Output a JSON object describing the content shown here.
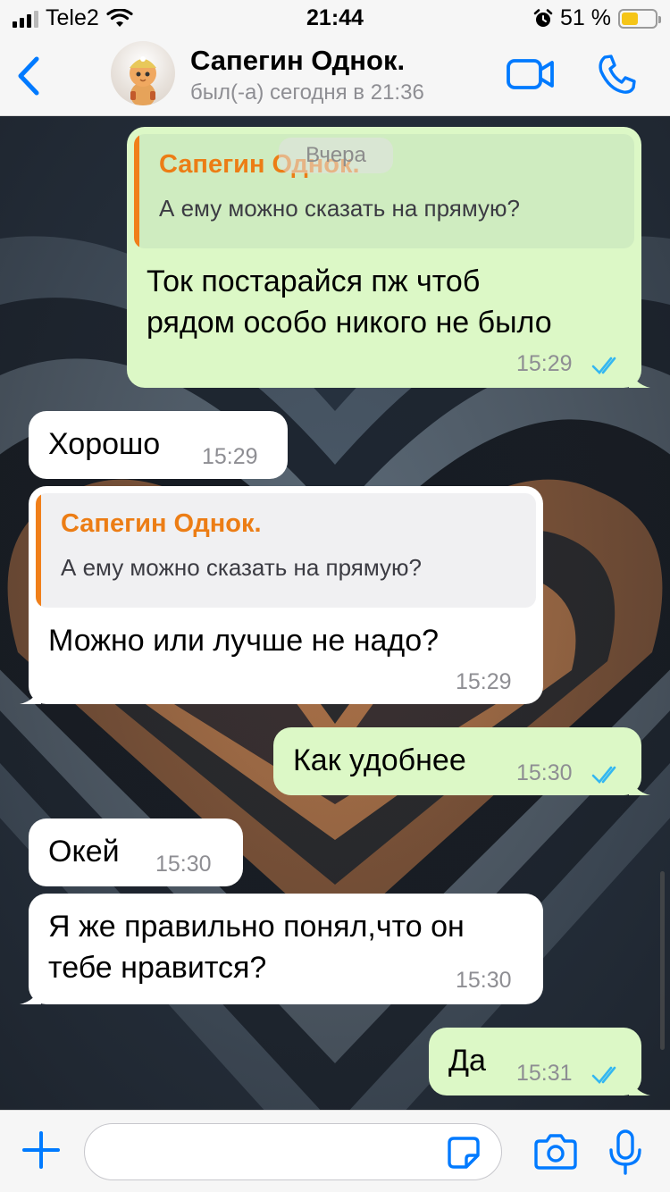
{
  "status_bar": {
    "carrier": "Tele2",
    "time": "21:44",
    "battery": "51 %",
    "battery_level": 0.51
  },
  "header": {
    "contact_name": "Сапегин Однок.",
    "last_seen": "был(-а) сегодня в 21:36"
  },
  "chat": {
    "date_label": "Вчера",
    "messages": [
      {
        "direction": "out",
        "quote": {
          "name": "Сапегин Однок.",
          "text": "А ему можно сказать на прямую?"
        },
        "text_lines": [
          "Ток постарайся пж чтоб",
          "рядом особо никого не было"
        ],
        "time": "15:29",
        "read": true
      },
      {
        "direction": "in",
        "text_lines": [
          "Хорошо"
        ],
        "time": "15:29"
      },
      {
        "direction": "in",
        "quote": {
          "name": "Сапегин Однок.",
          "text": "А ему можно сказать на прямую?"
        },
        "text_lines": [
          "Можно или лучше не надо?"
        ],
        "time": "15:29"
      },
      {
        "direction": "out",
        "text_lines": [
          "Как удобнее"
        ],
        "time": "15:30",
        "read": true
      },
      {
        "direction": "in",
        "text_lines": [
          "Окей"
        ],
        "time": "15:30"
      },
      {
        "direction": "in",
        "text_lines": [
          "Я же правильно понял,что он",
          "тебе нравится?"
        ],
        "time": "15:30"
      },
      {
        "direction": "out",
        "text_lines": [
          "Да"
        ],
        "time": "15:31",
        "read": true
      }
    ]
  },
  "input_bar": {
    "placeholder": ""
  },
  "icons": {
    "back": "chevron-left-icon",
    "video": "video-camera-icon",
    "call": "phone-icon",
    "plus": "plus-icon",
    "sticker": "sticker-icon",
    "camera": "camera-icon",
    "mic": "microphone-icon"
  },
  "colors": {
    "accent": "#007aff",
    "outgoing_bubble": "#dcf8c6",
    "incoming_bubble": "#ffffff",
    "quote_name": "#ec7d15",
    "read_ticks": "#34b7f1"
  }
}
